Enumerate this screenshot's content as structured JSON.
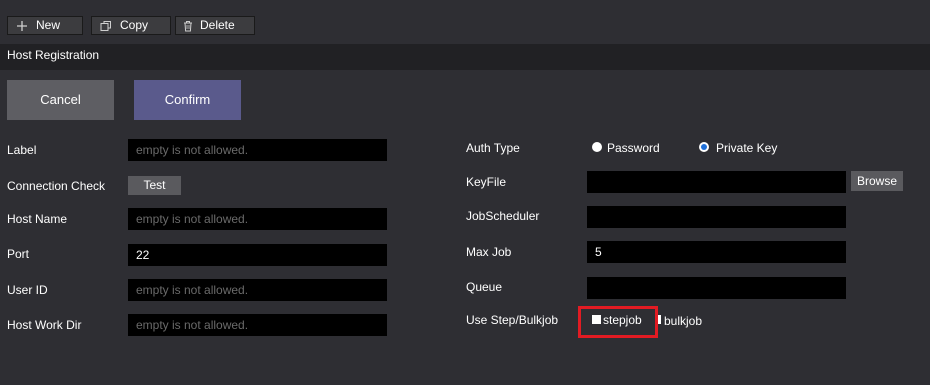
{
  "toolbar": {
    "new_label": "New",
    "copy_label": "Copy",
    "delete_label": "Delete"
  },
  "section": {
    "title": "Host Registration"
  },
  "actions": {
    "cancel_label": "Cancel",
    "confirm_label": "Confirm"
  },
  "form_left": {
    "label": {
      "label": "Label",
      "placeholder": "empty is not allowed."
    },
    "connection_check": {
      "label": "Connection Check",
      "button": "Test"
    },
    "host_name": {
      "label": "Host Name",
      "placeholder": "empty is not allowed."
    },
    "port": {
      "label": "Port",
      "value": "22"
    },
    "user_id": {
      "label": "User ID",
      "placeholder": "empty is not allowed."
    },
    "host_work_dir": {
      "label": "Host Work Dir",
      "placeholder": "empty is not allowed."
    }
  },
  "form_right": {
    "auth_type": {
      "label": "Auth Type",
      "options": [
        "Password",
        "Private Key"
      ],
      "selected": "Private Key"
    },
    "keyfile": {
      "label": "KeyFile",
      "value": "",
      "button": "Browse"
    },
    "jobscheduler": {
      "label": "JobScheduler",
      "value": ""
    },
    "max_job": {
      "label": "Max Job",
      "value": "5"
    },
    "queue": {
      "label": "Queue",
      "value": ""
    },
    "use_step_bulkjob": {
      "label": "Use Step/Bulkjob",
      "options": [
        "stepjob",
        "bulkjob"
      ]
    }
  },
  "colors": {
    "background": "#2e2e33",
    "section_bar": "#212124",
    "confirm": "#5a5a8c",
    "cancel": "#5e5e63",
    "highlight": "#e21b23",
    "radio_selected": "#1e6fd9"
  }
}
